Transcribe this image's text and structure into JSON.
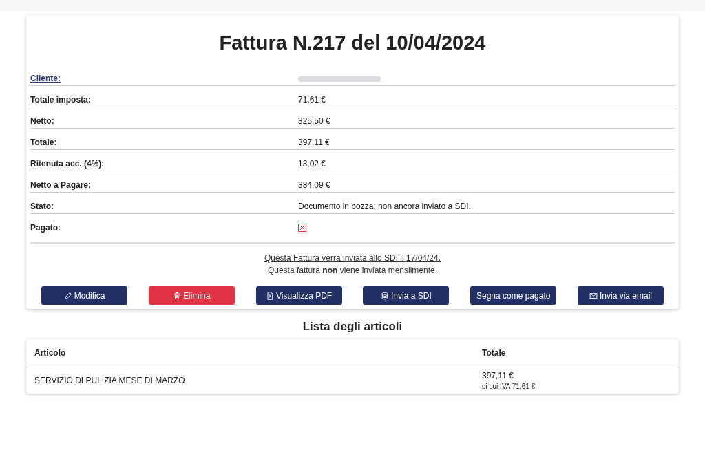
{
  "title": "Fattura N.217 del 10/04/2024",
  "details": [
    {
      "label": "Cliente:",
      "kind": "link",
      "redacted": true
    },
    {
      "label": "Totale imposta:",
      "kind": "text",
      "value": "71,61 €"
    },
    {
      "label": "Netto:",
      "kind": "text",
      "value": "325,50 €"
    },
    {
      "label": "Totale:",
      "kind": "text",
      "value": "397,11 €"
    },
    {
      "label": "Ritenuta acc. (4%):",
      "kind": "text",
      "value": "13,02 €"
    },
    {
      "label": "Netto a Pagare:",
      "kind": "text",
      "value": "384,09 €"
    },
    {
      "label": "Stato:",
      "kind": "text",
      "value": "Documento in bozza, non ancora inviato a SDI."
    },
    {
      "label": "Pagato:",
      "kind": "status",
      "paid": false
    }
  ],
  "notes": [
    "Questa Fattura verrà inviata allo SDI il 17/04/24.",
    "Questa fattura **non** viene inviata mensilmente."
  ],
  "buttons": [
    "Modifica",
    "Elimina",
    "Visualizza PDF",
    "Invia a SDI",
    "Segna come pagato",
    "Invia via email"
  ],
  "items_title": "Lista degli articoli",
  "table": {
    "columns": [
      "Articolo",
      "Totale"
    ],
    "rows": [
      {
        "articolo": "SERVIZIO DI PULIZIA MESE DI MARZO",
        "totale": "397,11 €",
        "iva": "di cui IVA 71,61 €"
      }
    ]
  }
}
